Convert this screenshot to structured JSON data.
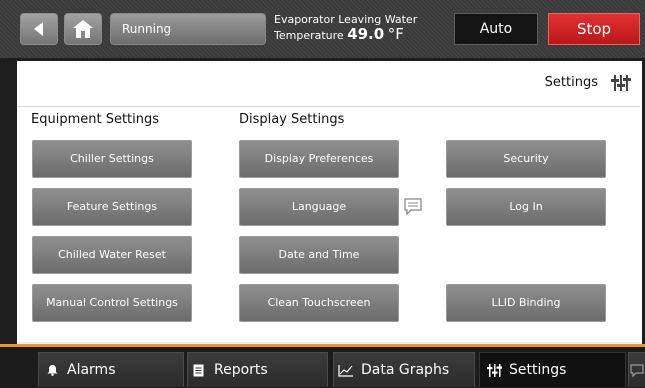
{
  "header": {
    "back_icon": "left-arrow-icon",
    "home_icon": "home-icon",
    "status": "Running",
    "evap_label_line1": "Evaporator Leaving Water",
    "evap_label_line2": "Temperature",
    "evap_value": "49.0",
    "evap_unit": "°F",
    "mode_label": "Auto",
    "stop_label": "Stop",
    "stop_color": "#d02626"
  },
  "page": {
    "title": "Settings",
    "icon": "settings-sliders-icon"
  },
  "columns": {
    "equipment_title": "Equipment Settings",
    "display_title": "Display Settings"
  },
  "buttons": {
    "chiller_settings": "Chiller Settings",
    "feature_settings": "Feature Settings",
    "chilled_water_reset": "Chilled Water Reset",
    "manual_control_settings": "Manual Control Settings",
    "display_preferences": "Display Preferences",
    "language": "Language",
    "date_and_time": "Date and Time",
    "clean_touchscreen": "Clean Touchscreen",
    "security": "Security",
    "log_in": "Log In",
    "llid_binding": "LLID Binding"
  },
  "tabs": {
    "alarms": "Alarms",
    "reports": "Reports",
    "data_graphs": "Data Graphs",
    "settings": "Settings",
    "active": "settings",
    "accent_color": "#e79a2f"
  }
}
